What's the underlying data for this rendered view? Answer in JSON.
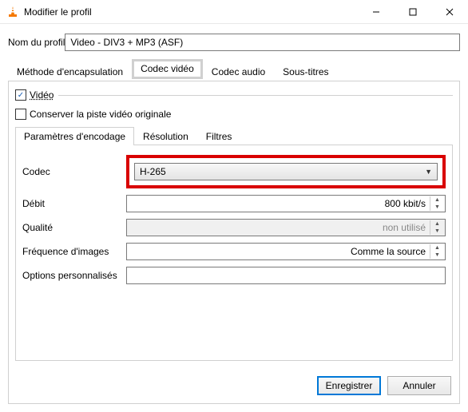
{
  "window": {
    "title": "Modifier le profil"
  },
  "profile": {
    "label": "Nom du profil",
    "value": "Video - DIV3 + MP3 (ASF)"
  },
  "tabs": {
    "encapsulation": "Méthode d'encapsulation",
    "video": "Codec vidéo",
    "audio": "Codec audio",
    "subtitles": "Sous-titres"
  },
  "video": {
    "checkbox_label": "Vidéo",
    "keep_original": "Conserver la piste vidéo originale",
    "subtabs": {
      "encoding": "Paramètres d'encodage",
      "resolution": "Résolution",
      "filters": "Filtres"
    },
    "codec_label": "Codec",
    "codec_value": "H-265",
    "bitrate_label": "Débit",
    "bitrate_value": "800 kbit/s",
    "quality_label": "Qualité",
    "quality_value": "non utilisé",
    "framerate_label": "Fréquence d'images",
    "framerate_value": "Comme la source",
    "custom_label": "Options personnalisés"
  },
  "buttons": {
    "save": "Enregistrer",
    "cancel": "Annuler"
  }
}
